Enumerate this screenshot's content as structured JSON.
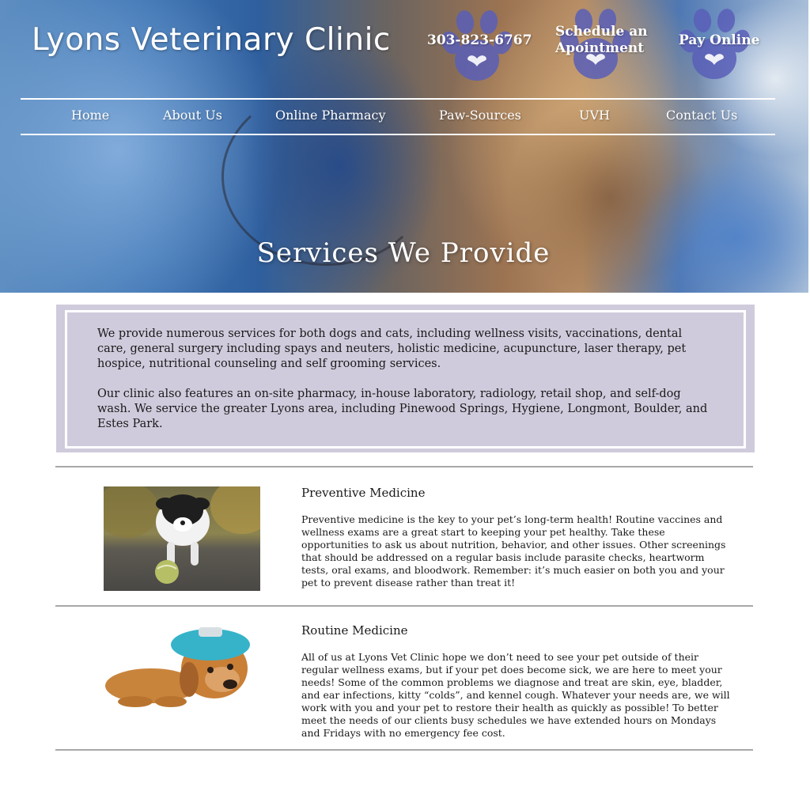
{
  "header": {
    "logo_text": "Lyons Veterinary Clinic",
    "phone": "303-823-6767",
    "schedule_line1": "Schedule an",
    "schedule_line2": "Apointment",
    "pay_online": "Pay Online"
  },
  "nav": {
    "items": [
      {
        "label": "Home"
      },
      {
        "label": "About Us"
      },
      {
        "label": "Online Pharmacy"
      },
      {
        "label": "Paw-Sources"
      },
      {
        "label": "UVH"
      },
      {
        "label": "Contact Us"
      }
    ]
  },
  "hero": {
    "title": "Services We Provide"
  },
  "intro": {
    "paragraph1": "We provide numerous services for both dogs and cats, including wellness visits, vaccinations, dental care, general surgery including spays and neuters, holistic medicine, acupuncture, laser therapy, pet hospice, nutritional counseling and self grooming services.",
    "paragraph2": "Our clinic also features an on-site pharmacy, in-house laboratory, radiology, retail shop, and self-dog wash. We service the greater Lyons area, including Pinewood Springs, Hygiene, Longmont, Boulder, and Estes Park."
  },
  "services": [
    {
      "title": "Preventive Medicine",
      "text": "Preventive medicine is the key to your pet’s long-term health! Routine vaccines and wellness exams are a great start to keeping your pet healthy. Take these opportunities to ask us about nutrition, behavior, and other issues. Other screenings that should be addressed on a regular basis include parasite checks, heartworm tests, oral exams, and bloodwork. Remember: it’s much easier on both you and your pet to prevent disease rather than treat it!"
    },
    {
      "title": "Routine Medicine",
      "text": "All of us at Lyons Vet Clinic hope we don’t need to see your pet outside of their regular wellness exams, but if your pet does become sick, we are here to meet your needs! Some of the common problems we diagnose and treat are skin, eye, bladder, and ear infections, kitty “colds”, and kennel cough. Whatever your needs are, we will work with you and your pet to restore their health as quickly as possible! To better meet the needs of our clients busy schedules we have extended hours on Mondays and Fridays with no emergency fee cost."
    }
  ],
  "colors": {
    "paw_icon": "#5a5fb8",
    "intro_box": "#d0cbdc",
    "divider": "#a8a8a8"
  }
}
